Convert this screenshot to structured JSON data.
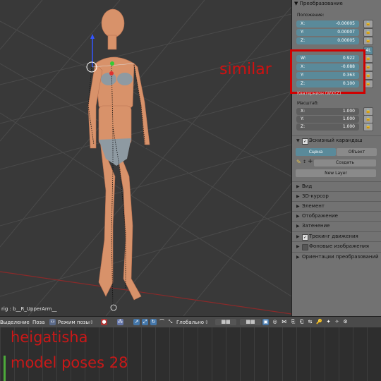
{
  "viewport": {
    "annotation": "similar",
    "object_name": "rig : b__R_UpperArm__"
  },
  "panel": {
    "transform_header": "Преобразование",
    "location_label": "Положение:",
    "location": [
      {
        "axis": "X:",
        "value": "-0.00005"
      },
      {
        "axis": "Y:",
        "value": "0.00007"
      },
      {
        "axis": "Z:",
        "value": "0.00005"
      }
    ],
    "rotation_mode_badge": "4L",
    "rotation": [
      {
        "axis": "W:",
        "value": "0.922"
      },
      {
        "axis": "X:",
        "value": "-0.088"
      },
      {
        "axis": "Y:",
        "value": "0.363"
      },
      {
        "axis": "Z:",
        "value": "0.100"
      }
    ],
    "rotation_mode_label": "Кватернион (WXYZ)",
    "scale_label": "Масштаб:",
    "scale": [
      {
        "axis": "X:",
        "value": "1.000"
      },
      {
        "axis": "Y:",
        "value": "1.000"
      },
      {
        "axis": "Z:",
        "value": "1.000"
      }
    ],
    "grease_pencil_header": "Эскизный карандаш",
    "tab_scene": "Сцена",
    "tab_object": "Объект",
    "create_label": "Создать",
    "new_layer_label": "New Layer",
    "sections": [
      {
        "label": "Вид",
        "check": "none"
      },
      {
        "label": "3D-курсор",
        "check": "none"
      },
      {
        "label": "Элемент",
        "check": "none"
      },
      {
        "label": "Отображение",
        "check": "none"
      },
      {
        "label": "Затенение",
        "check": "none"
      },
      {
        "label": "Трекинг движения",
        "check": "on"
      },
      {
        "label": "Фоновые изображения",
        "check": "off"
      },
      {
        "label": "Ориентации преобразований",
        "check": "none"
      }
    ]
  },
  "header3d": {
    "select_label": "Выделение",
    "pose_label": "Поза",
    "mode_label": "Режим позы",
    "pivot_label": "Глобально"
  },
  "watermark": {
    "line1": "heigatisha",
    "line2": "model poses 28"
  },
  "colors": {
    "accent": "#5a8a9a",
    "highlight_box": "#d00000",
    "watermark": "#c91818"
  }
}
